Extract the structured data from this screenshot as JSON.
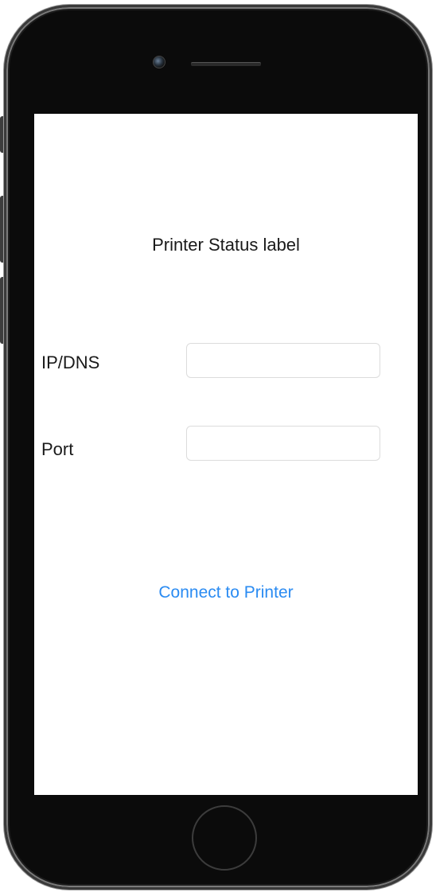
{
  "screen": {
    "status_label": "Printer Status label",
    "ip_label": "IP/DNS",
    "ip_value": "",
    "port_label": "Port",
    "port_value": "",
    "connect_button_label": "Connect to Printer"
  },
  "colors": {
    "accent": "#2a8bf2",
    "text": "#1a1a1a",
    "bezel": "#0b0b0b"
  },
  "device": {
    "camera_icon": "camera-icon",
    "speaker_icon": "speaker-grille-icon",
    "home_icon": "home-button-icon"
  }
}
